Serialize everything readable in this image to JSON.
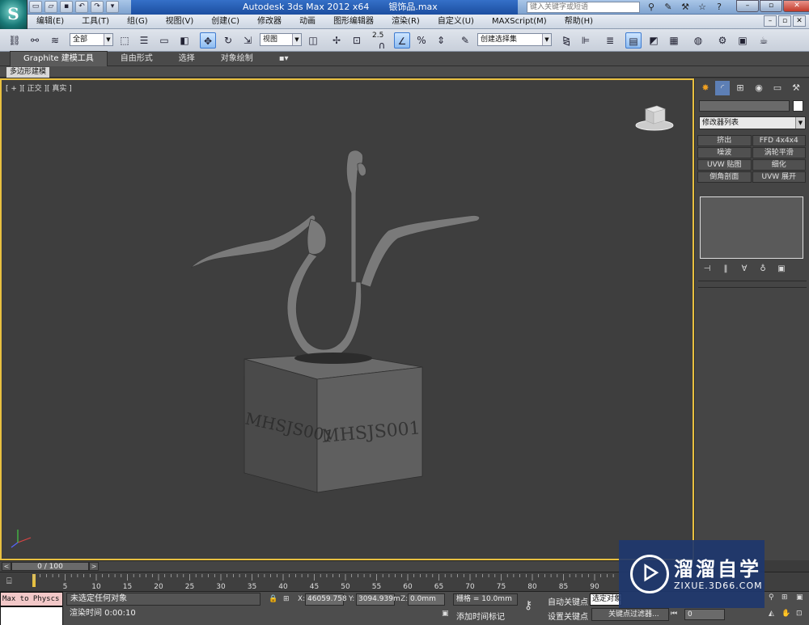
{
  "window": {
    "app_title": "Autodesk 3ds Max  2012 x64",
    "file_name": "银饰品.max",
    "search_placeholder": "键入关键字或短语",
    "logo_text": "S"
  },
  "menu": [
    "编辑(E)",
    "工具(T)",
    "组(G)",
    "视图(V)",
    "创建(C)",
    "修改器",
    "动画",
    "图形编辑器",
    "渲染(R)",
    "自定义(U)",
    "MAXScript(M)",
    "帮助(H)"
  ],
  "toolbar": {
    "selection_filter": "全部",
    "ref_coord": "视图",
    "snap_value": "2.5",
    "named_selection": "创建选择集"
  },
  "ribbon": {
    "tabs": [
      "Graphite 建模工具",
      "自由形式",
      "选择",
      "对象绘制"
    ],
    "sub_tab": "多边形建模"
  },
  "viewport": {
    "label": "[ + ][ 正交 ][ 真实 ]",
    "engraving": "MHSJS001"
  },
  "command_panel": {
    "modifier_list": "修改器列表",
    "modifier_buttons": [
      "挤出",
      "FFD 4x4x4",
      "噪波",
      "涡轮平滑",
      "UVW 贴图",
      "细化",
      "倒角剖面",
      "UVW 展开"
    ]
  },
  "time_slider": {
    "frame": "0 / 100"
  },
  "track": {
    "ticks": [
      "5",
      "10",
      "15",
      "20",
      "25",
      "30",
      "35",
      "40",
      "45",
      "50",
      "55",
      "60",
      "65",
      "70",
      "75",
      "80",
      "85",
      "90"
    ]
  },
  "status": {
    "maxscript": "Max to Physcs (",
    "selection": "未选定任何对象",
    "render_time": "渲染时间  0:00:10",
    "x_label": "X:",
    "x": "46059.758",
    "y_label": "Y:",
    "y": "3094.939m",
    "z_label": "Z:",
    "z": "0.0mm",
    "grid": "栅格 = 10.0mm",
    "add_time_tag": "添加时间标记",
    "auto_key": "自动关键点",
    "set_key": "设置关键点",
    "selected": "选定对象",
    "key_filter": "关键点过滤器...",
    "frame": "0"
  },
  "watermark": {
    "title": "溜溜自学",
    "url": "ZIXUE.3D66.COM"
  },
  "colors": {
    "viewport_border": "#e8c040",
    "title_blue": "#1c4ea0"
  }
}
